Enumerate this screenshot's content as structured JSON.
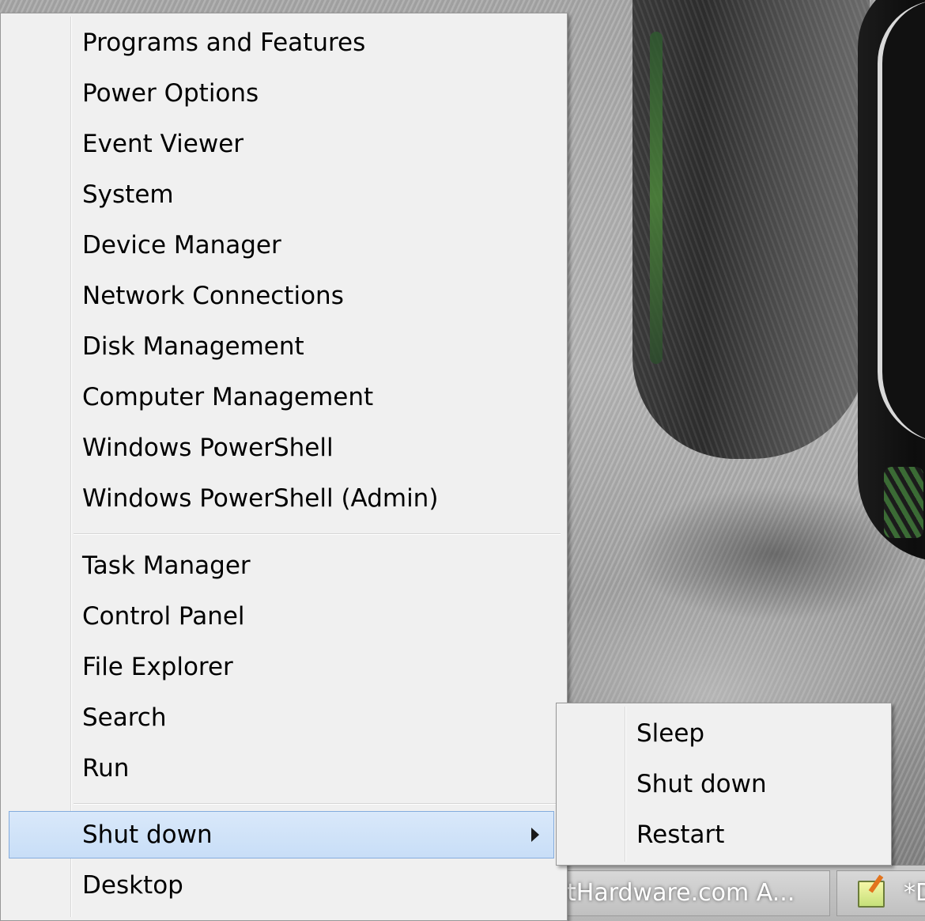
{
  "menu": {
    "items_group1": [
      {
        "label": "Programs and Features"
      },
      {
        "label": "Power Options"
      },
      {
        "label": "Event Viewer"
      },
      {
        "label": "System"
      },
      {
        "label": "Device Manager"
      },
      {
        "label": "Network Connections"
      },
      {
        "label": "Disk Management"
      },
      {
        "label": "Computer Management"
      },
      {
        "label": "Windows PowerShell"
      },
      {
        "label": "Windows PowerShell (Admin)"
      }
    ],
    "items_group2": [
      {
        "label": "Task Manager"
      },
      {
        "label": "Control Panel"
      },
      {
        "label": "File Explorer"
      },
      {
        "label": "Search"
      },
      {
        "label": "Run"
      }
    ],
    "items_group3": [
      {
        "label": "Shut down",
        "highlighted": true,
        "has_submenu": true
      },
      {
        "label": "Desktop"
      }
    ]
  },
  "submenu": {
    "items": [
      {
        "label": "Sleep"
      },
      {
        "label": "Shut down"
      },
      {
        "label": "Restart"
      }
    ]
  },
  "taskbar": {
    "buttons": [
      {
        "label": "tHardware.com A..."
      },
      {
        "label": "*D",
        "icon": "notepad-icon"
      }
    ]
  },
  "colors": {
    "menu_background": "#f0f0f0",
    "highlight_background": "#c8def7",
    "highlight_border": "#84acdd",
    "text": "#000000"
  }
}
